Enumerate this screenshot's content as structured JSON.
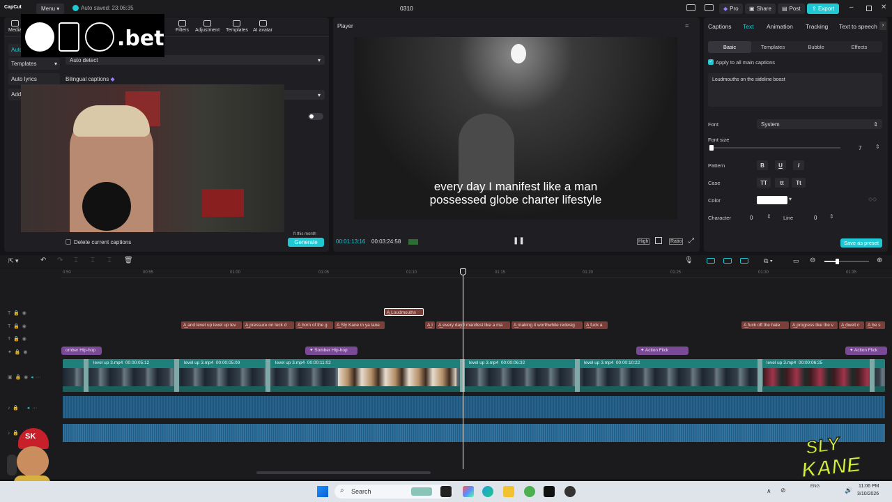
{
  "titlebar": {
    "app_name": "CapCut",
    "menu_label": "Menu",
    "autosave": "Auto saved: 23:06:35",
    "project_title": "0310",
    "pro_label": "Pro",
    "share_label": "Share",
    "post_label": "Post",
    "export_label": "Export"
  },
  "toolbar": {
    "items": [
      "Media",
      "Filters",
      "Adjustment",
      "Templates",
      "AI avatar"
    ]
  },
  "overlay_logo": {
    "text": "b86.bet"
  },
  "left_panel": {
    "side_items": [
      "Auto",
      "Templates",
      "Auto lyrics",
      "Add"
    ],
    "language_value": "Auto detect",
    "bilingual_label": "Bilingual captions",
    "delete_label": "Delete current captions",
    "generate_label": "Generate",
    "free_note": "ft this month"
  },
  "player": {
    "title": "Player",
    "subtitle_line1": "every day I manifest like a man",
    "subtitle_line2": "possessed globe charter lifestyle",
    "time_current": "00:01:13:16",
    "time_total": "00:03:24:58",
    "quality_label": "High",
    "ratio_label": "Ratio"
  },
  "right_panel": {
    "tabs": [
      "Captions",
      "Text",
      "Animation",
      "Tracking",
      "Text to speech"
    ],
    "active_tab": "Text",
    "subtabs": [
      "Basic",
      "Templates",
      "Bubble",
      "Effects"
    ],
    "apply_all_label": "Apply to all main captions",
    "caption_text": "Loudmouths on the sideline boost",
    "font_label": "Font",
    "font_value": "System",
    "font_size_label": "Font size",
    "font_size_value": "7",
    "pattern_label": "Pattern",
    "pattern_buttons": [
      "B",
      "U",
      "I"
    ],
    "case_label": "Case",
    "case_buttons": [
      "TT",
      "tt",
      "Tt"
    ],
    "color_label": "Color",
    "color_value": "#ffffff",
    "character_label": "Character",
    "character_value": "0",
    "line_label": "Line",
    "line_value": "0",
    "save_preset_label": "Save as preset"
  },
  "timeline": {
    "ruler_labels": [
      "0:50",
      "00:55",
      "01:00",
      "01:05",
      "01:10",
      "01:15",
      "01:20",
      "01:25",
      "01:30",
      "01:35"
    ],
    "selected_caption": "Loudmouths",
    "captions": [
      "and level up level up lev",
      "pressure on lock d",
      "born of the g",
      "Sly Kane in ya lane",
      "I",
      "every day I manifest like a ma",
      "making it worthwhile redesig",
      "fuck a",
      "fuck off the hate",
      "progress like the v",
      "dwell c",
      "be s"
    ],
    "effects": [
      "omber Hip-hop",
      "Somber Hip-hop",
      "Action Flick",
      "Action Flick"
    ],
    "video_clips": [
      {
        "label": "level up 3.mp4",
        "duration": "00:00:05:12"
      },
      {
        "label": "level up 3.mp4",
        "duration": "00:00:05:09"
      },
      {
        "label": "level up 3.mp4",
        "duration": "00:00:11:02"
      },
      {
        "label": "level up 3.mp4",
        "duration": "00:00:06:32"
      },
      {
        "label": "level up 3.mp4",
        "duration": "00:00:10:22"
      },
      {
        "label": "level up 3.mp4",
        "duration": "00:00:06:25"
      }
    ]
  },
  "branding": {
    "sk_badge": "SK",
    "sly_kane_line1": "SLY",
    "sly_kane_line2": "KANE"
  },
  "taskbar": {
    "search_label": "Search",
    "lang": "ENG",
    "time": "11:06 PM",
    "date": "3/10/2026"
  },
  "colors": {
    "accent": "#1fc8d2",
    "caption_clip": "#7b3f3a",
    "effect_clip": "#7b4a96",
    "video_clip": "#1f7f7a",
    "audio_track": "#1d4f74"
  }
}
